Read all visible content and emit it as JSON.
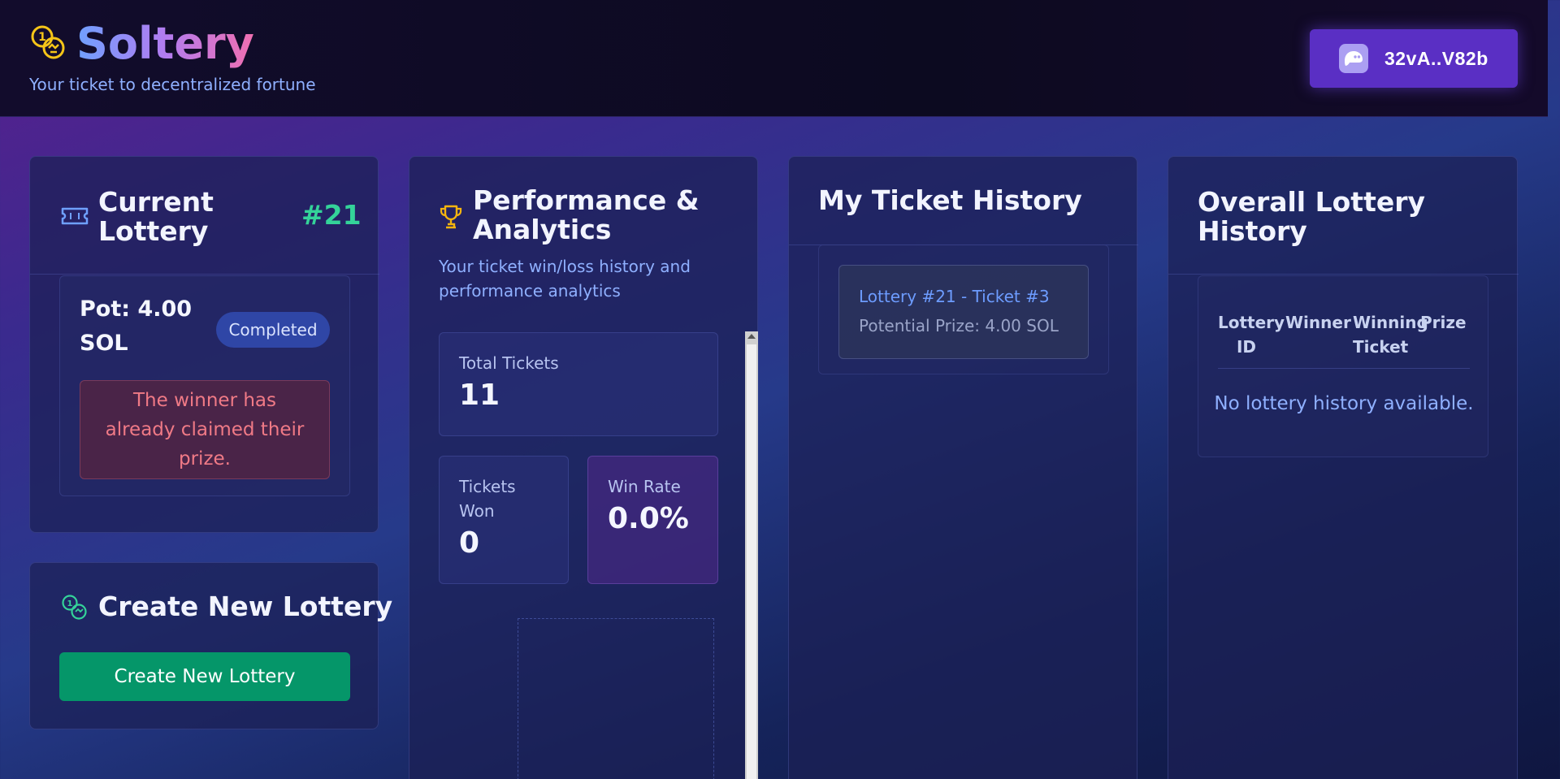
{
  "header": {
    "title": "Soltery",
    "subtitle": "Your ticket to decentralized fortune",
    "wallet_address": "32vA..V82b"
  },
  "current_lottery": {
    "title": "Current Lottery",
    "number": "#21",
    "pot": "Pot: 4.00 SOL",
    "status": "Completed",
    "message": "The winner has already claimed their prize."
  },
  "create_lottery": {
    "title": "Create New Lottery",
    "button_label": "Create New Lottery"
  },
  "performance": {
    "title": "Performance & Analytics",
    "subtitle": "Your ticket win/loss history and performance analytics",
    "stats": {
      "total_tickets": {
        "label": "Total Tickets",
        "value": "11"
      },
      "tickets_won": {
        "label": "Tickets Won",
        "value": "0"
      },
      "win_rate": {
        "label": "Win Rate",
        "value": "0.0%"
      }
    }
  },
  "ticket_history": {
    "title": "My Ticket History",
    "items": [
      {
        "label": "Lottery #21 - Ticket #3",
        "prize": "Potential Prize: 4.00 SOL"
      }
    ]
  },
  "overall_history": {
    "title": "Overall Lottery History",
    "columns": [
      "Lottery ID",
      "Winner",
      "Winning Ticket",
      "Prize"
    ],
    "empty_message": "No lottery history available."
  },
  "colors": {
    "accent_green": "#34d399",
    "button_green": "#059669",
    "wallet_purple": "#5a2fc4",
    "link_blue": "#6d9cff",
    "alert_red": "#f07a86"
  },
  "icons": {
    "brand": "coins-icon",
    "wallet": "phantom-ghost-icon",
    "current_lottery": "ticket-icon",
    "create_lottery": "coins-icon",
    "performance": "trophy-icon"
  }
}
